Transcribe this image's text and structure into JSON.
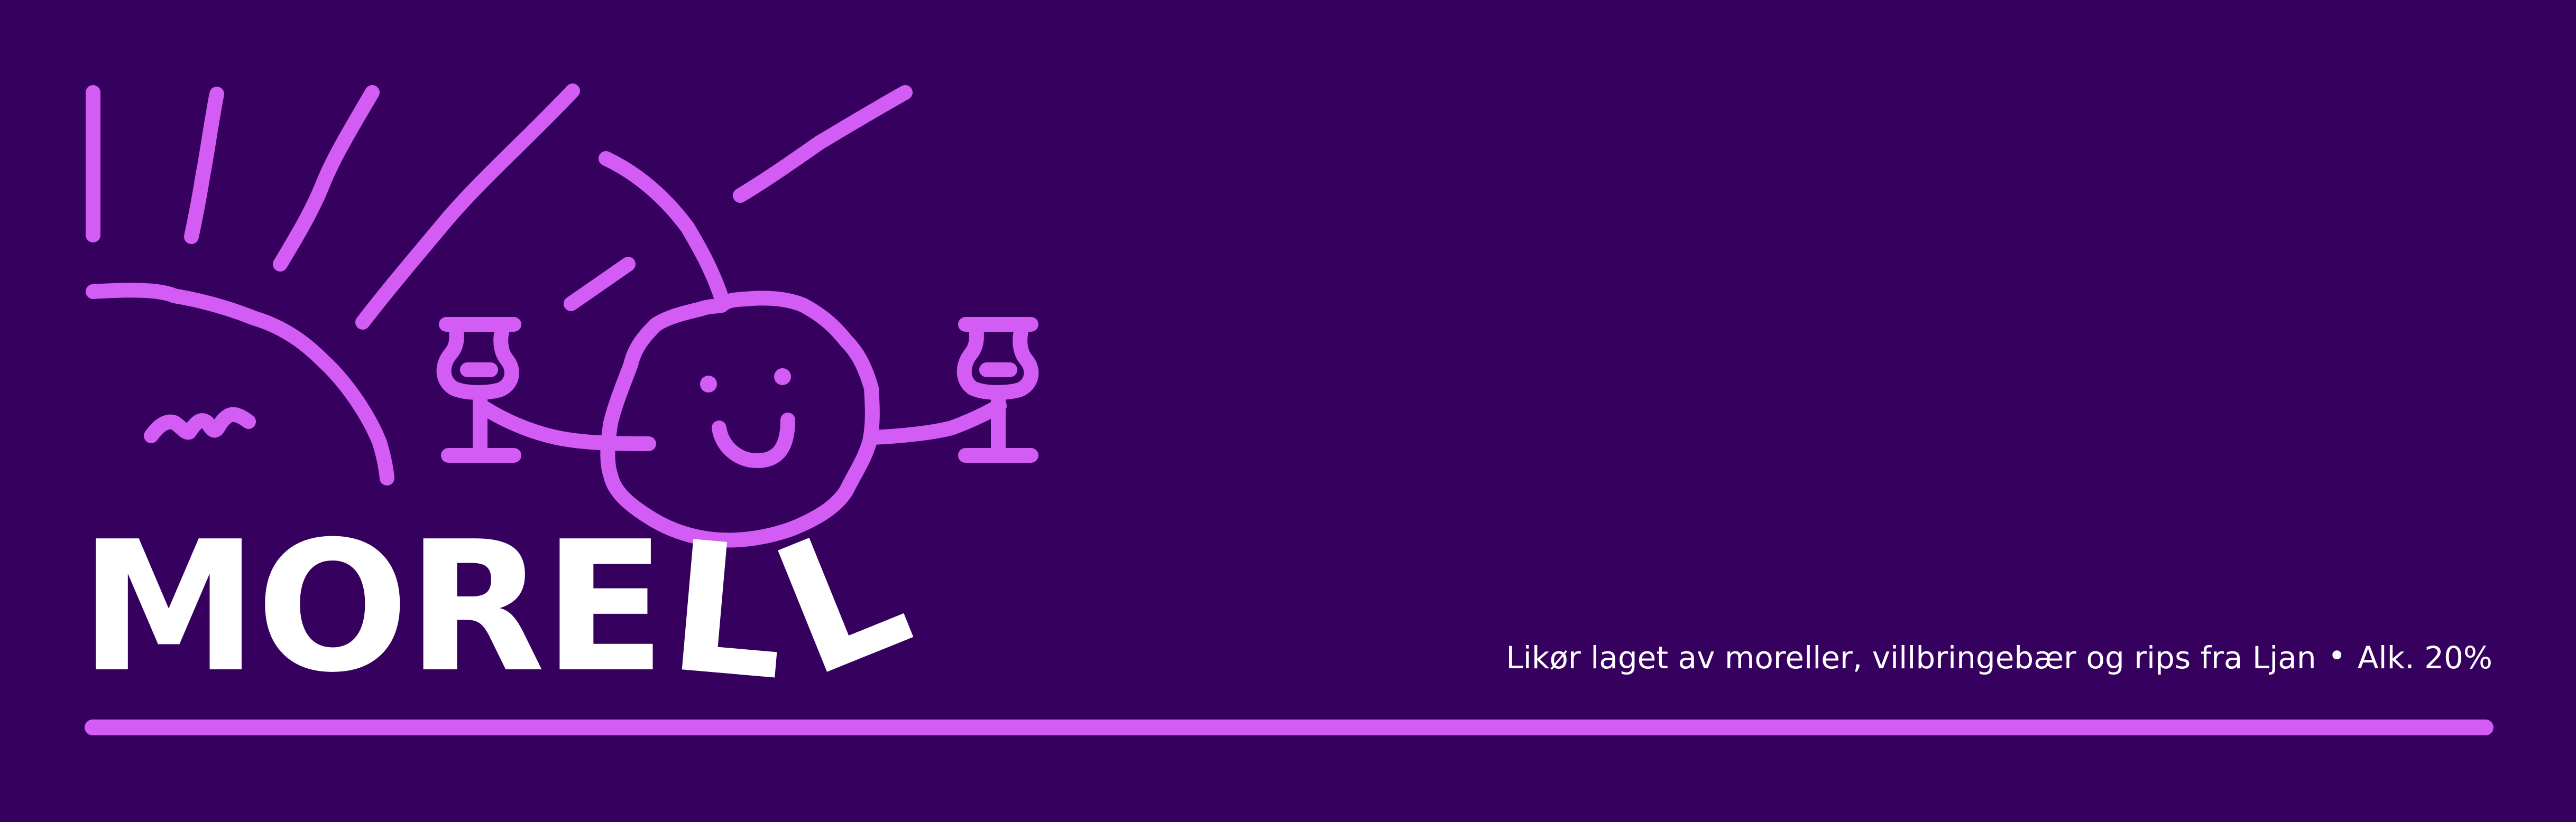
{
  "label": {
    "brand": {
      "letters": [
        "M",
        "O",
        "R",
        "E",
        "L",
        "L"
      ]
    },
    "tagline": {
      "description": "Likør laget av moreller, villbringebær og rips fra Ljan",
      "separator": "•",
      "alcohol": "Alk. 20%"
    }
  },
  "illustration": {
    "sun": "sun-rays-icon",
    "hill": "hill-icon",
    "bird": "bird-icon",
    "cherry": "cherry-character-icon",
    "glasses": "wine-glass-icon"
  },
  "colors": {
    "background": "#36005f",
    "accent": "#d35cf4",
    "text": "#ffffff"
  }
}
